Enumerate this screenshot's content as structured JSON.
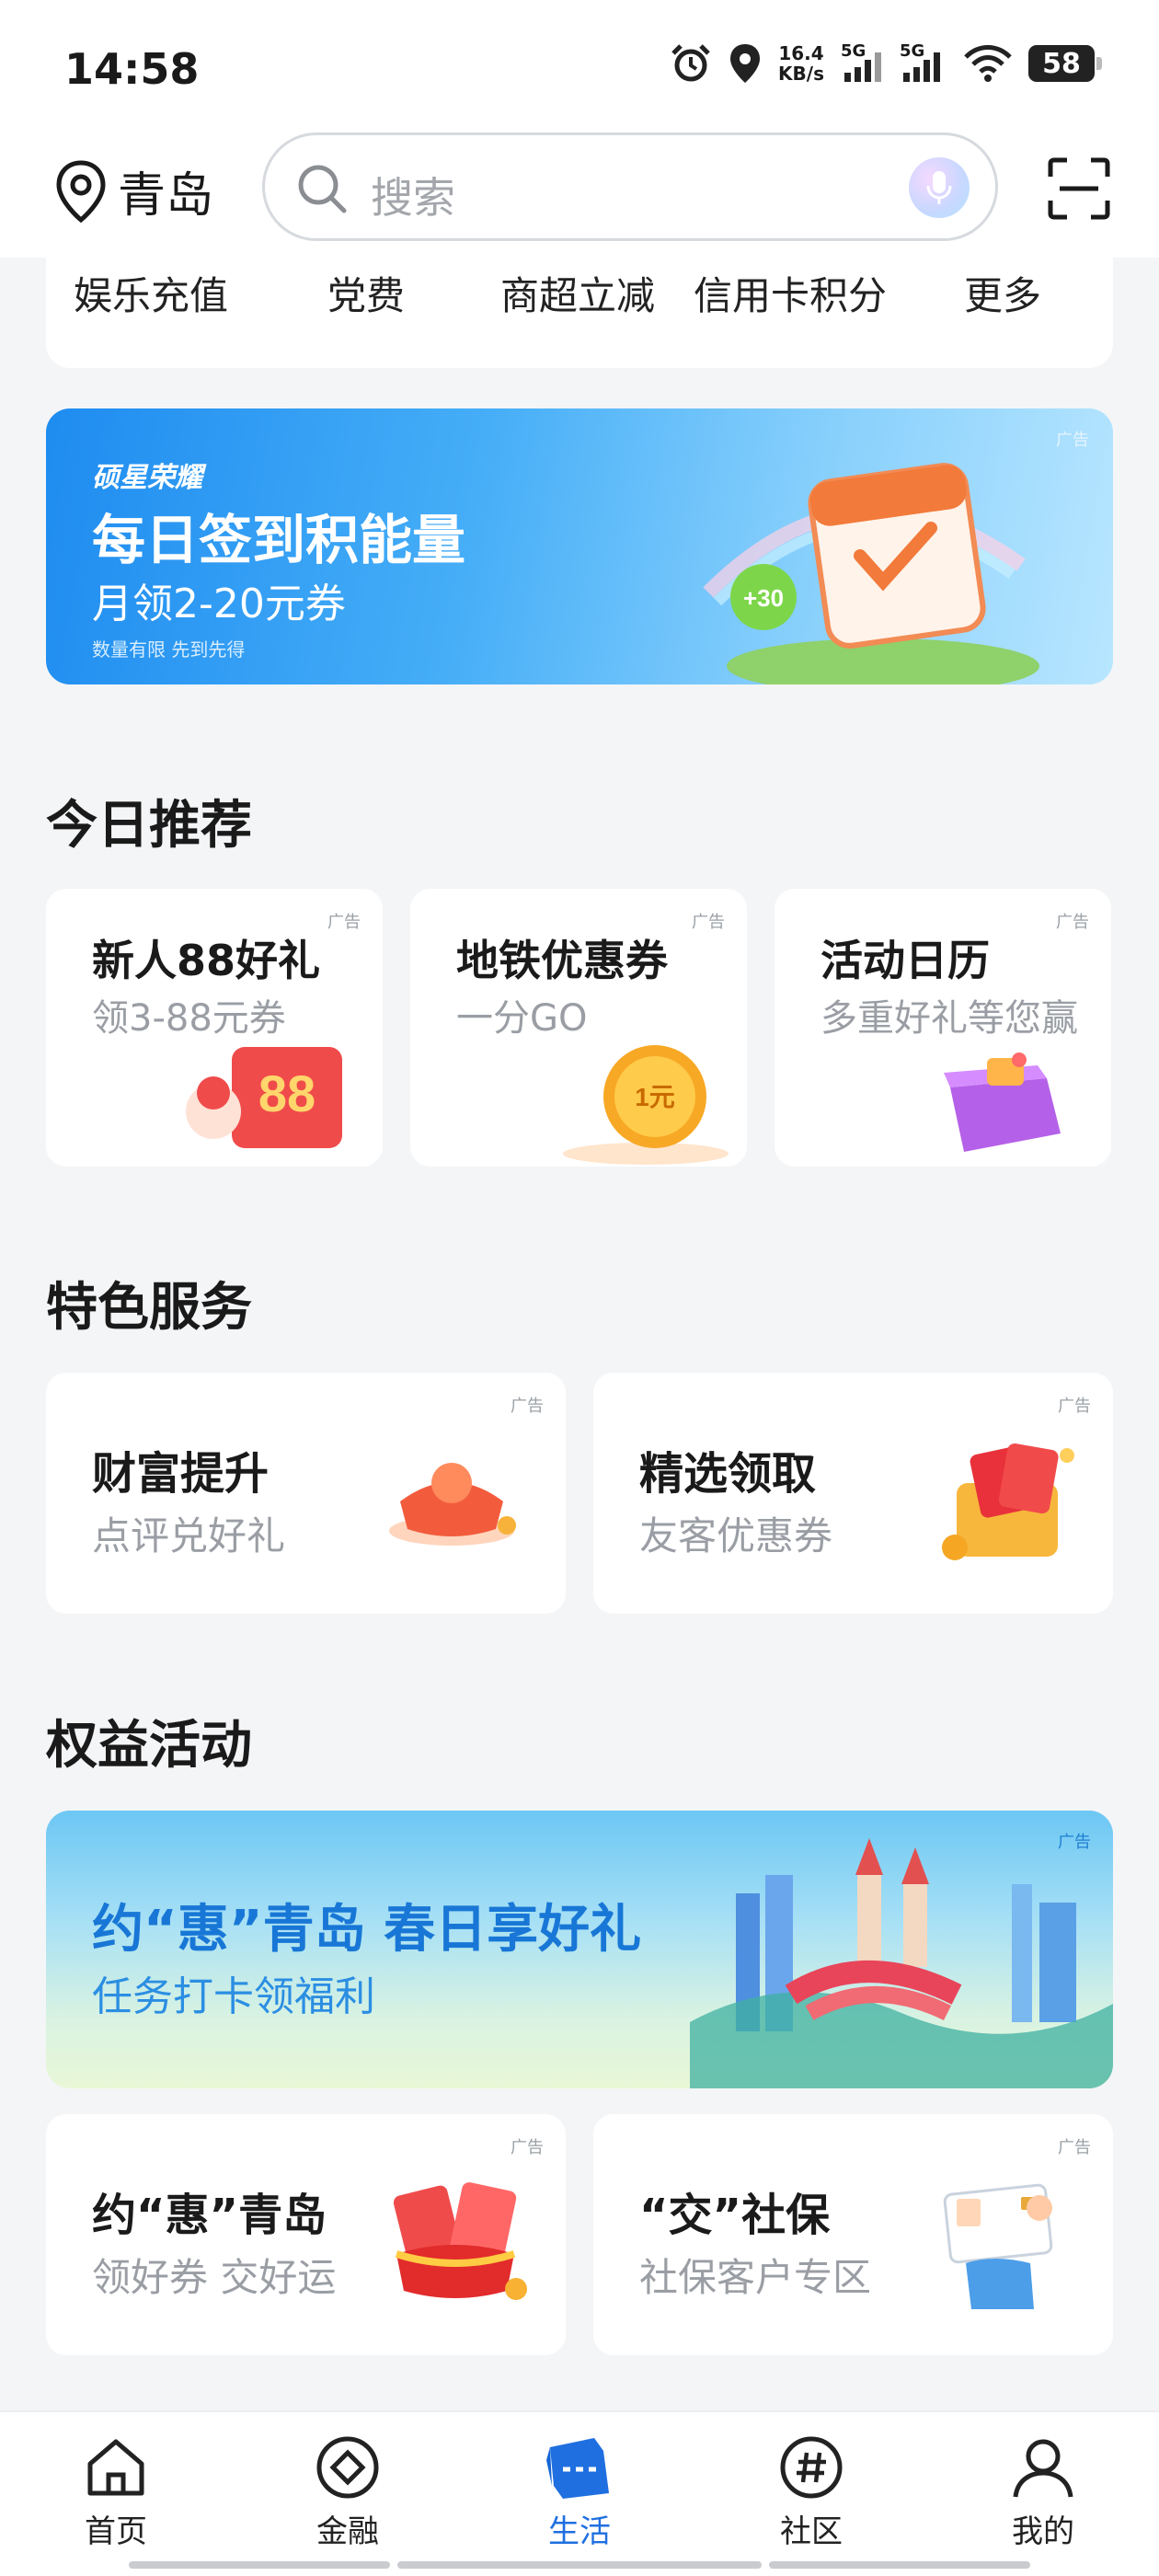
{
  "status_bar": {
    "time": "14:58",
    "net_speed_top": "16.4",
    "net_speed_bottom": "KB/s",
    "sig1_label": "5G",
    "sig2_label": "5G",
    "battery": "58"
  },
  "header": {
    "city": "青岛",
    "search_placeholder": "搜索"
  },
  "quick_links": [
    "娱乐充值",
    "党费",
    "商超立减",
    "信用卡积分",
    "更多"
  ],
  "banner_top": {
    "brand": "硕星荣耀",
    "title": "每日签到积能量",
    "subtitle": "月领2-20元券",
    "note": "数量有限  先到先得",
    "ad": "广告",
    "badge": "+30"
  },
  "today": {
    "title": "今日推荐",
    "cards": [
      {
        "title": "新人88好礼",
        "subtitle": "领3-88元券",
        "ad": "广告",
        "img_text": "88"
      },
      {
        "title": "地铁优惠券",
        "subtitle": "一分GO",
        "ad": "广告",
        "img_text": "1元"
      },
      {
        "title": "活动日历",
        "subtitle": "多重好礼等您赢",
        "ad": "广告"
      }
    ]
  },
  "services": {
    "title": "特色服务",
    "cards": [
      {
        "title": "财富提升",
        "subtitle": "点评兑好礼",
        "ad": "广告"
      },
      {
        "title": "精选领取",
        "subtitle": "友客优惠券",
        "ad": "广告"
      }
    ]
  },
  "benefits": {
    "title": "权益活动",
    "banner": {
      "title": "约“惠”青岛 春日享好礼",
      "subtitle": "任务打卡领福利",
      "ad": "广告"
    },
    "cards": [
      {
        "title": "约“惠”青岛",
        "subtitle": "领好券 交好运",
        "ad": "广告"
      },
      {
        "title": "“交”社保",
        "subtitle": "社保客户专区",
        "ad": "广告"
      }
    ]
  },
  "bottom_nav": [
    {
      "label": "首页",
      "icon": "home-icon",
      "active": false
    },
    {
      "label": "金融",
      "icon": "finance-icon",
      "active": false
    },
    {
      "label": "生活",
      "icon": "ticket-icon",
      "active": true
    },
    {
      "label": "社区",
      "icon": "hashtag-icon",
      "active": false
    },
    {
      "label": "我的",
      "icon": "user-icon",
      "active": false
    }
  ],
  "colors": {
    "accent": "#1f6fe0",
    "background": "#f4f5f7",
    "banner_blue": "#1e8cf0"
  }
}
